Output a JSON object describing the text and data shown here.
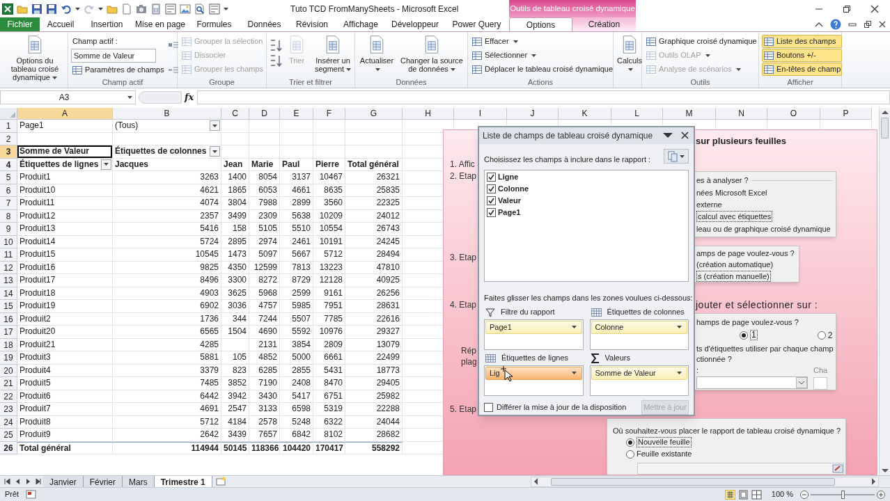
{
  "window": {
    "title": "Tuto TCD FromManySheets - Microsoft Excel",
    "context_tab_group": "Outils de tableau croisé dynamique"
  },
  "tabs": [
    {
      "label": "Fichier",
      "selected": false,
      "kind": "file",
      "contextual": false
    },
    {
      "label": "Accueil",
      "selected": false,
      "kind": "tab",
      "contextual": false
    },
    {
      "label": "Insertion",
      "selected": false,
      "kind": "tab",
      "contextual": false
    },
    {
      "label": "Mise en page",
      "selected": false,
      "kind": "tab",
      "contextual": false
    },
    {
      "label": "Formules",
      "selected": false,
      "kind": "tab",
      "contextual": false
    },
    {
      "label": "Données",
      "selected": false,
      "kind": "tab",
      "contextual": false
    },
    {
      "label": "Révision",
      "selected": false,
      "kind": "tab",
      "contextual": false
    },
    {
      "label": "Affichage",
      "selected": false,
      "kind": "tab",
      "contextual": false
    },
    {
      "label": "Développeur",
      "selected": false,
      "kind": "tab",
      "contextual": false
    },
    {
      "label": "Power Query",
      "selected": false,
      "kind": "tab",
      "contextual": false
    },
    {
      "label": "Options",
      "selected": true,
      "kind": "tab",
      "contextual": true
    },
    {
      "label": "Création",
      "selected": false,
      "kind": "tab",
      "contextual": true
    }
  ],
  "ribbon": {
    "groups": [
      {
        "items": [
          {
            "kind": "large",
            "label": "Options du tableau croisé dynamique",
            "menu": true,
            "disabled": false
          }
        ]
      },
      {
        "label": "Champ actif",
        "items": [
          {
            "kind": "caption",
            "label": "Champ actif :"
          },
          {
            "kind": "field",
            "value": "Somme de Valeur"
          },
          {
            "kind": "small",
            "label": "Paramètres de champs",
            "disabled": false
          }
        ]
      },
      {
        "label": "Groupe",
        "items": [
          {
            "kind": "small",
            "label": "Grouper la sélection",
            "disabled": true
          },
          {
            "kind": "small",
            "label": "Dissocier",
            "disabled": true
          },
          {
            "kind": "small",
            "label": "Grouper les champs",
            "disabled": true
          }
        ]
      },
      {
        "label": "Trier et filtrer",
        "items": [
          {
            "kind": "sort"
          },
          {
            "kind": "large",
            "label": "Trier",
            "disabled": true
          },
          {
            "kind": "large",
            "label": "Insérer un segment",
            "menu": true,
            "disabled": false
          }
        ]
      },
      {
        "label": "Données",
        "items": [
          {
            "kind": "large",
            "label": "Actualiser",
            "menu": true,
            "disabled": false
          },
          {
            "kind": "large",
            "label": "Changer la source de données",
            "menu": true,
            "disabled": false
          }
        ]
      },
      {
        "label": "Actions",
        "items": [
          {
            "kind": "small",
            "label": "Effacer",
            "menu": true,
            "disabled": false
          },
          {
            "kind": "small",
            "label": "Sélectionner",
            "menu": true,
            "disabled": false
          },
          {
            "kind": "small",
            "label": "Déplacer le tableau croisé dynamique",
            "disabled": false
          }
        ]
      },
      {
        "items": [
          {
            "kind": "large",
            "label": "Calculs",
            "menu": true,
            "disabled": false
          }
        ]
      },
      {
        "label": "Outils",
        "items": [
          {
            "kind": "small",
            "label": "Graphique croisé dynamique",
            "disabled": false
          },
          {
            "kind": "small",
            "label": "Outils OLAP",
            "menu": true,
            "disabled": true
          },
          {
            "kind": "small",
            "label": "Analyse de scénarios",
            "menu": true,
            "disabled": true
          }
        ]
      },
      {
        "label": "Afficher",
        "items": [
          {
            "kind": "toggle",
            "label": "Liste des champs",
            "on": true
          },
          {
            "kind": "toggle",
            "label": "Boutons +/-",
            "on": true
          },
          {
            "kind": "toggle",
            "label": "En-têtes de champ",
            "on": true
          }
        ]
      }
    ]
  },
  "formula_bar": {
    "name_box": "A3",
    "function_label": "fx"
  },
  "sheet": {
    "columns": [
      "A",
      "B",
      "C",
      "D",
      "E",
      "F",
      "G",
      "H",
      "I",
      "J",
      "K",
      "L",
      "M",
      "N",
      "O",
      "P"
    ],
    "rows": [
      {
        "number": "1",
        "kind": "filter",
        "cells": [
          "Page1",
          {
            "text": "(Tous)",
            "dropdown": true
          }
        ]
      },
      {
        "number": "2",
        "kind": "data"
      },
      {
        "number": "3",
        "kind": "header",
        "cells": [
          {
            "text": "Somme de Valeur",
            "selected": true
          },
          {
            "text": "Étiquettes de colonnes",
            "dropdown": true
          }
        ]
      },
      {
        "number": "4",
        "kind": "header",
        "cells": [
          {
            "text": "Étiquettes de lignes",
            "dropdown": true
          },
          "Jacques",
          "Jean",
          "Marie",
          "Paul",
          "Pierre",
          "Total général"
        ]
      },
      {
        "number": "5",
        "kind": "data",
        "cells": [
          "Produit1",
          "3263",
          "1400",
          "8054",
          "3137",
          "10467",
          "26321"
        ]
      },
      {
        "number": "6",
        "kind": "data",
        "cells": [
          "Produit10",
          "4621",
          "1865",
          "6053",
          "4661",
          "8635",
          "25835"
        ]
      },
      {
        "number": "7",
        "kind": "data",
        "cells": [
          "Produit11",
          "4074",
          "3804",
          "7988",
          "2899",
          "3560",
          "22325"
        ]
      },
      {
        "number": "8",
        "kind": "data",
        "cells": [
          "Produit12",
          "2357",
          "3499",
          "2309",
          "5638",
          "10209",
          "24012"
        ]
      },
      {
        "number": "9",
        "kind": "data",
        "cells": [
          "Produit13",
          "5416",
          "158",
          "5105",
          "5510",
          "10554",
          "26743"
        ]
      },
      {
        "number": "10",
        "kind": "data",
        "cells": [
          "Produit14",
          "5724",
          "2895",
          "2974",
          "2461",
          "10191",
          "24245"
        ]
      },
      {
        "number": "11",
        "kind": "data",
        "cells": [
          "Produit15",
          "10545",
          "1473",
          "5097",
          "5667",
          "5712",
          "28494"
        ]
      },
      {
        "number": "12",
        "kind": "data",
        "cells": [
          "Produit16",
          "9825",
          "4350",
          "12599",
          "7813",
          "13223",
          "47810"
        ]
      },
      {
        "number": "13",
        "kind": "data",
        "cells": [
          "Produit17",
          "8496",
          "3300",
          "8272",
          "8729",
          "12128",
          "40925"
        ]
      },
      {
        "number": "14",
        "kind": "data",
        "cells": [
          "Produit18",
          "4903",
          "3625",
          "5968",
          "2599",
          "9161",
          "26256"
        ]
      },
      {
        "number": "15",
        "kind": "data",
        "cells": [
          "Produit19",
          "6902",
          "3036",
          "4757",
          "5985",
          "7951",
          "28631"
        ]
      },
      {
        "number": "16",
        "kind": "data",
        "cells": [
          "Produit2",
          "1736",
          "344",
          "7244",
          "5507",
          "7785",
          "22616"
        ]
      },
      {
        "number": "17",
        "kind": "data",
        "cells": [
          "Produit20",
          "6565",
          "1504",
          "4690",
          "5592",
          "10976",
          "29327"
        ]
      },
      {
        "number": "18",
        "kind": "data",
        "cells": [
          "Produit21",
          "4285",
          null,
          "2131",
          "3854",
          "2809",
          "13079"
        ]
      },
      {
        "number": "19",
        "kind": "data",
        "cells": [
          "Produit3",
          "5881",
          "105",
          "4852",
          "5000",
          "6661",
          "22499"
        ]
      },
      {
        "number": "20",
        "kind": "data",
        "cells": [
          "Produit4",
          "3379",
          "823",
          "6285",
          "2855",
          "5431",
          "18773"
        ]
      },
      {
        "number": "21",
        "kind": "data",
        "cells": [
          "Produit5",
          "7485",
          "3852",
          "7190",
          "2408",
          "8470",
          "29405"
        ]
      },
      {
        "number": "22",
        "kind": "data",
        "cells": [
          "Produit6",
          "6442",
          "3942",
          "3430",
          "5417",
          "6751",
          "25982"
        ]
      },
      {
        "number": "23",
        "kind": "data",
        "cells": [
          "Produit7",
          "4691",
          "2547",
          "3133",
          "6598",
          "5319",
          "22288"
        ]
      },
      {
        "number": "24",
        "kind": "data",
        "cells": [
          "Produit8",
          "5712",
          "4184",
          "2578",
          "5248",
          "6322",
          "24044"
        ]
      },
      {
        "number": "25",
        "kind": "data",
        "cells": [
          "Produit9",
          "2642",
          "3439",
          "7657",
          "6842",
          "8102",
          "28682"
        ]
      },
      {
        "number": "26",
        "kind": "total",
        "cells": [
          "Total général",
          "114944",
          "50145",
          "118366",
          "104420",
          "170417",
          "558292"
        ]
      }
    ]
  },
  "tutorial_image": {
    "heading": "sur plusieurs feuilles",
    "steps": [
      "1. Affic",
      "2. Etap",
      "3. Etap",
      "4. Etap",
      "Rép",
      "plag",
      "5. Etap"
    ],
    "note": "jouter et sélectionner sur :",
    "dialogs": [
      {
        "items": [
          {
            "kind": "heading",
            "text": "es à analyser ?"
          },
          {
            "kind": "text",
            "text": "nées Microsoft Excel"
          },
          {
            "kind": "text",
            "text": "externe"
          },
          {
            "kind": "focus",
            "text": "calcul avec étiquettes"
          },
          {
            "kind": "text",
            "text": "leau ou de graphique croisé dynamique"
          }
        ]
      },
      {
        "items": [
          {
            "kind": "text",
            "text": "amps de page voulez-vous ?"
          },
          {
            "kind": "text",
            "text": "(création automatique)"
          },
          {
            "kind": "focus",
            "text": "s (création manuelle)"
          }
        ]
      },
      {
        "items": [
          {
            "kind": "text",
            "text": "hamps de page voulez-vous ?"
          },
          {
            "kind": "radios",
            "options": [
              {
                "label": "1",
                "selected": true
              },
              {
                "label": "2",
                "selected": false
              }
            ]
          },
          {
            "kind": "text",
            "text": "ts d'étiquettes utiliser par chaque champ"
          },
          {
            "kind": "text",
            "text": "ctionnée ?"
          },
          {
            "kind": "combo_row",
            "label": ":",
            "caption": "Cha"
          }
        ]
      },
      {
        "items": [
          {
            "kind": "text",
            "text": "Où souhaitez-vous placer le rapport de tableau croisé dynamique ?"
          },
          {
            "kind": "radio",
            "text": "Nouvelle feuille",
            "selected": true
          },
          {
            "kind": "radio",
            "text": "Feuille existante",
            "selected": false
          },
          {
            "kind": "range"
          }
        ]
      }
    ]
  },
  "field_list": {
    "title": "Liste de champs de tableau croisé dynamique",
    "instruction": "Choisissez les champs à inclure dans le rapport :",
    "fields": [
      {
        "label": "Ligne",
        "checked": true
      },
      {
        "label": "Colonne",
        "checked": true
      },
      {
        "label": "Valeur",
        "checked": true
      },
      {
        "label": "Page1",
        "checked": true
      }
    ],
    "drag_hint": "Faites glisser les champs dans les zones voulues ci-dessous:",
    "areas": [
      {
        "title": "Filtre du rapport",
        "kind": "filter",
        "items": [
          {
            "label": "Page1",
            "highlighted": false
          }
        ]
      },
      {
        "title": "Étiquettes de colonnes",
        "kind": "columns",
        "items": [
          {
            "label": "Colonne",
            "highlighted": false
          }
        ]
      },
      {
        "title": "Étiquettes de lignes",
        "kind": "rows",
        "items": [
          {
            "label": "Lig",
            "highlighted": true
          }
        ]
      },
      {
        "title": "Valeurs",
        "kind": "values",
        "items": [
          {
            "label": "Somme de Valeur",
            "highlighted": false
          }
        ]
      }
    ],
    "defer": {
      "label": "Différer la mise à jour de la disposition",
      "checked": false
    },
    "update_button": {
      "label": "Mettre à jour",
      "disabled": true
    }
  },
  "sheet_tabs": [
    {
      "label": "Janvier",
      "selected": false
    },
    {
      "label": "Février",
      "selected": false
    },
    {
      "label": "Mars",
      "selected": false
    },
    {
      "label": "Trimestre 1",
      "selected": true
    }
  ],
  "status_bar": {
    "mode": "Prêt",
    "zoom": "100 %",
    "zoom_slider": {
      "level": 0.5
    }
  }
}
